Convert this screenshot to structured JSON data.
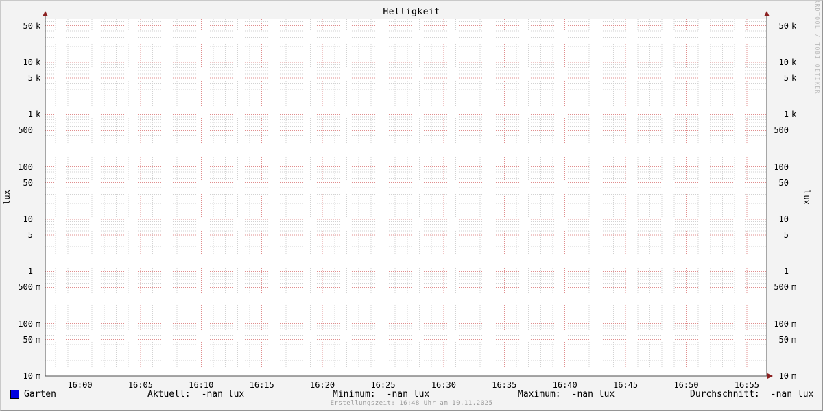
{
  "title": "Helligkeit",
  "watermark": "RRDTOOL / TOBI OETIKER",
  "footer": "Erstellungszeit: 16:48 Uhr am 10.11.2025",
  "y_axis": {
    "unit_label": "lux",
    "ticks": [
      {
        "value": 50000,
        "num": "50",
        "suffix": "k"
      },
      {
        "value": 10000,
        "num": "10",
        "suffix": "k"
      },
      {
        "value": 5000,
        "num": "5",
        "suffix": "k"
      },
      {
        "value": 1000,
        "num": "1",
        "suffix": "k"
      },
      {
        "value": 500,
        "num": "500",
        "suffix": ""
      },
      {
        "value": 100,
        "num": "100",
        "suffix": ""
      },
      {
        "value": 50,
        "num": "50",
        "suffix": ""
      },
      {
        "value": 10,
        "num": "10",
        "suffix": ""
      },
      {
        "value": 5,
        "num": "5",
        "suffix": ""
      },
      {
        "value": 1,
        "num": "1",
        "suffix": ""
      },
      {
        "value": 0.5,
        "num": "500",
        "suffix": "m"
      },
      {
        "value": 0.1,
        "num": "100",
        "suffix": "m"
      },
      {
        "value": 0.05,
        "num": "50",
        "suffix": "m"
      },
      {
        "value": 0.01,
        "num": "10",
        "suffix": "m"
      }
    ]
  },
  "x_axis": {
    "ticks": [
      {
        "m": 0,
        "label": "16:00"
      },
      {
        "m": 5,
        "label": "16:05"
      },
      {
        "m": 10,
        "label": "16:10"
      },
      {
        "m": 15,
        "label": "16:15"
      },
      {
        "m": 20,
        "label": "16:20"
      },
      {
        "m": 25,
        "label": "16:25"
      },
      {
        "m": 30,
        "label": "16:30"
      },
      {
        "m": 35,
        "label": "16:35"
      },
      {
        "m": 40,
        "label": "16:40"
      },
      {
        "m": 45,
        "label": "16:45"
      },
      {
        "m": 50,
        "label": "16:50"
      },
      {
        "m": 55,
        "label": "16:55"
      }
    ]
  },
  "legend": {
    "series_label": "Garten",
    "series_color": "#0000e0",
    "stats": [
      {
        "label": "Aktuell:",
        "value": "-nan lux"
      },
      {
        "label": "Minimum:",
        "value": "-nan lux"
      },
      {
        "label": "Maximum:",
        "value": "-nan lux"
      },
      {
        "label": "Durchschnitt:",
        "value": "-nan lux"
      }
    ]
  },
  "colors": {
    "background": "#f3f3f3",
    "canvas": "#ffffff",
    "grid_minor": "#d2d2d2",
    "grid_major": "#e08d8d",
    "axis": "#4d4d4d",
    "arrow": "#8b2020",
    "series": "#0000e0",
    "watermark": "#b9b9b9",
    "footer_text": "#9a9a9a"
  },
  "chart_data": {
    "type": "line",
    "title": "Helligkeit",
    "xlabel": "",
    "ylabel": "lux",
    "yscale": "log",
    "ylim": [
      0.01,
      70000
    ],
    "xlim": [
      "15:57",
      "16:57"
    ],
    "x_tick_labels": [
      "16:00",
      "16:05",
      "16:10",
      "16:15",
      "16:20",
      "16:25",
      "16:30",
      "16:35",
      "16:40",
      "16:45",
      "16:50",
      "16:55"
    ],
    "y_tick_labels": [
      "50 k",
      "10 k",
      "5 k",
      "1 k",
      "500",
      "100",
      "50",
      "10",
      "5",
      "1",
      "500 m",
      "100 m",
      "50 m",
      "10 m"
    ],
    "grid": true,
    "legend_position": "bottom",
    "series": [
      {
        "name": "Garten",
        "color": "#0000e0",
        "x": [],
        "values": [],
        "note": "no data points plotted in window; all values NaN"
      }
    ],
    "stats": {
      "aktuell": "-nan lux",
      "minimum": "-nan lux",
      "maximum": "-nan lux",
      "durchschnitt": "-nan lux"
    }
  }
}
